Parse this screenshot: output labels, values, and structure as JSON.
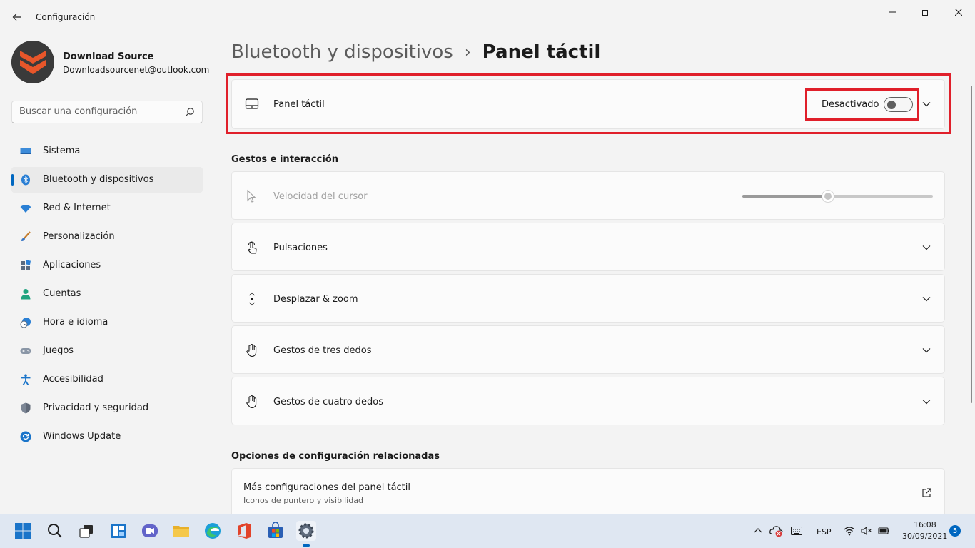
{
  "window": {
    "title": "Configuración",
    "back_icon": "arrow-left-icon",
    "controls": [
      "minimize-icon",
      "maximize-icon",
      "close-icon"
    ]
  },
  "profile": {
    "name": "Download Source",
    "email": "Downloadsourcenet@outlook.com",
    "avatar_color": "#e8562a"
  },
  "search": {
    "placeholder": "Buscar una configuración",
    "icon": "search-icon"
  },
  "sidebar": {
    "items": [
      {
        "label": "Sistema",
        "icon": "display-icon",
        "active": false
      },
      {
        "label": "Bluetooth y dispositivos",
        "icon": "bluetooth-icon",
        "active": true
      },
      {
        "label": "Red & Internet",
        "icon": "wifi-icon",
        "active": false
      },
      {
        "label": "Personalización",
        "icon": "brush-icon",
        "active": false
      },
      {
        "label": "Aplicaciones",
        "icon": "apps-icon",
        "active": false
      },
      {
        "label": "Cuentas",
        "icon": "person-icon",
        "active": false
      },
      {
        "label": "Hora e idioma",
        "icon": "clock-globe-icon",
        "active": false
      },
      {
        "label": "Juegos",
        "icon": "gamepad-icon",
        "active": false
      },
      {
        "label": "Accesibilidad",
        "icon": "accessibility-icon",
        "active": false
      },
      {
        "label": "Privacidad y seguridad",
        "icon": "shield-icon",
        "active": false
      },
      {
        "label": "Windows Update",
        "icon": "update-icon",
        "active": false
      }
    ]
  },
  "main": {
    "breadcrumb_parent": "Bluetooth y dispositivos",
    "breadcrumb_separator": "›",
    "breadcrumb_current": "Panel táctil",
    "touchpad_card": {
      "label": "Panel táctil",
      "state_label": "Desactivado",
      "toggle_on": false,
      "icon": "touchpad-icon"
    },
    "gestures_section": {
      "title": "Gestos e interacción",
      "cursor_speed": {
        "label": "Velocidad del cursor",
        "value": 0.45,
        "disabled": true,
        "icon": "cursor-icon"
      },
      "items": [
        {
          "label": "Pulsaciones",
          "icon": "tap-icon"
        },
        {
          "label": "Desplazar & zoom",
          "icon": "scroll-icon"
        },
        {
          "label": "Gestos de tres dedos",
          "icon": "hand-icon"
        },
        {
          "label": "Gestos de cuatro dedos",
          "icon": "hand-icon"
        }
      ]
    },
    "related_section": {
      "title": "Opciones de configuración relacionadas",
      "link_title": "Más configuraciones del panel táctil",
      "link_subtitle": "Iconos de puntero y visibilidad",
      "icon": "open-external-icon"
    }
  },
  "taskbar": {
    "apps": [
      "start-icon",
      "search-icon",
      "task-view-icon",
      "widgets-icon",
      "chat-icon",
      "file-explorer-icon",
      "edge-icon",
      "office-icon",
      "store-icon",
      "settings-icon"
    ],
    "language": "ESP",
    "time": "16:08",
    "date": "30/09/2021",
    "notifications": "5"
  },
  "colors": {
    "accent": "#0067c0",
    "highlight": "#e01f2a"
  }
}
